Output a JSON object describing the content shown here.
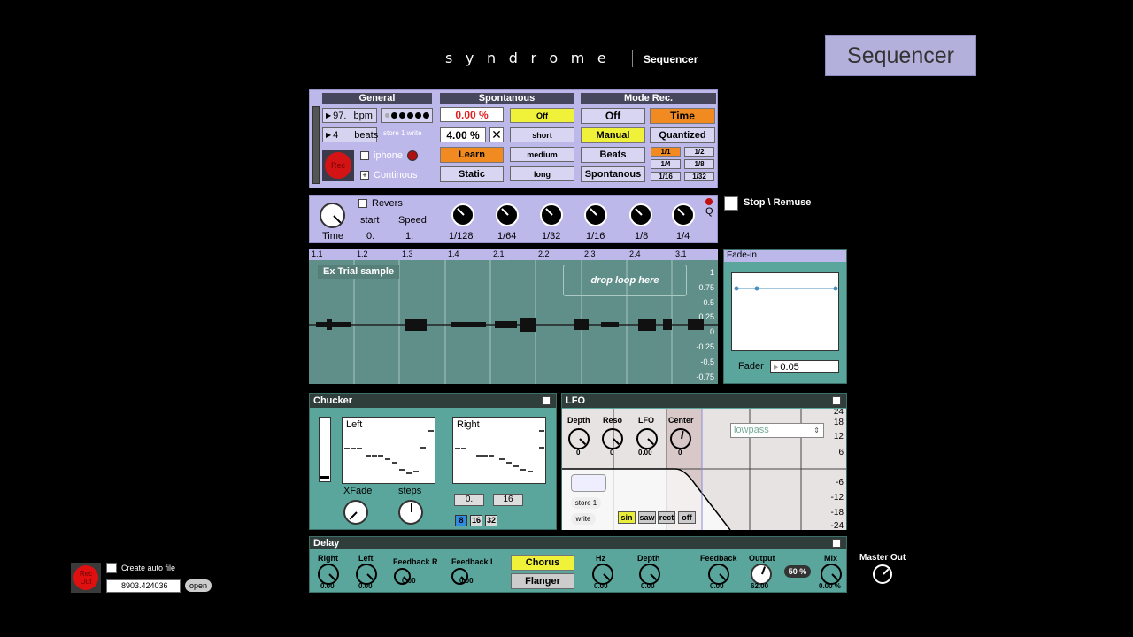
{
  "title": {
    "brand": "syndrome",
    "sub": "Sequencer"
  },
  "sequencer_button": "Sequencer",
  "general": {
    "header": "General",
    "bpm_value": "97.",
    "bpm_unit": "bpm",
    "beats_value": "4",
    "beats_unit": "beats",
    "store_write": "store 1 write",
    "rec_label": "Rec",
    "iphone_label": "iphone",
    "continous_label": "Continous"
  },
  "spontanous": {
    "header": "Spontanous",
    "percent1": "0.00 %",
    "percent2": "4.00 %",
    "learn": "Learn",
    "static": "Static",
    "off": "Off",
    "short": "short",
    "medium": "medium",
    "long": "long"
  },
  "mode_rec": {
    "header": "Mode Rec.",
    "off": "Off",
    "time": "Time",
    "manual": "Manual",
    "quantized": "Quantized",
    "beats": "Beats",
    "spontanous": "Spontanous",
    "fractions": [
      "1/1",
      "1/2",
      "1/4",
      "1/8",
      "1/16",
      "1/32"
    ]
  },
  "transport": {
    "time_label": "Time",
    "revers_label": "Revers",
    "start_label": "start",
    "speed_label": "Speed",
    "start_value": "0.",
    "speed_value": "1.",
    "knob_labels": [
      "1/128",
      "1/64",
      "1/32",
      "1/16",
      "1/8",
      "1/4"
    ],
    "q_label": "Q"
  },
  "stop_remuse": "Stop \\ Remuse",
  "waveform": {
    "ruler": [
      "1.1",
      "1.2",
      "1.3",
      "1.4",
      "2.1",
      "2.2",
      "2.3",
      "2.4",
      "3.1"
    ],
    "sample_name": "Ex Trial sample",
    "drop_hint": "drop loop here",
    "scale": [
      "1",
      "0.75",
      "0.5",
      "0.25",
      "0",
      "-0.25",
      "-0.5",
      "-0.75"
    ]
  },
  "fade_in": {
    "header": "Fade-in",
    "fader_label": "Fader",
    "fader_value": "0.05"
  },
  "chucker": {
    "header": "Chucker",
    "left_label": "Left",
    "right_label": "Right",
    "xfade_label": "XFade",
    "steps_label": "steps",
    "val_a": "0.",
    "val_b": "16",
    "step_options": [
      "8",
      "16",
      "32"
    ]
  },
  "lfo": {
    "header": "LFO",
    "knob_labels": [
      "Depth",
      "Reso",
      "LFO",
      "Center"
    ],
    "knob_values": [
      "0",
      "0",
      "0.00",
      "0"
    ],
    "filter_type": "lowpass",
    "scale": [
      "24",
      "18",
      "12",
      "6",
      "-6",
      "-12",
      "-18",
      "-24"
    ],
    "store": "store 1",
    "write": "write",
    "waves": [
      "sin",
      "saw",
      "rect",
      "off"
    ]
  },
  "delay": {
    "header": "Delay",
    "knobs": [
      {
        "label": "Right",
        "value": "0.00"
      },
      {
        "label": "Left",
        "value": "0.00"
      },
      {
        "label": "Feedback R",
        "value": "0.00"
      },
      {
        "label": "Feedback L",
        "value": "0.00"
      }
    ],
    "chorus": "Chorus",
    "flanger": "Flanger",
    "knobs2": [
      {
        "label": "Hz",
        "value": "0.00"
      },
      {
        "label": "Depth",
        "value": "0.00"
      },
      {
        "label": "Feedback",
        "value": "0.00"
      },
      {
        "label": "Output",
        "value": "62.00"
      },
      {
        "label": "Mix",
        "value": "0.00 %"
      }
    ],
    "percent_badge": "50 %"
  },
  "master_out": "Master Out",
  "rec_out": {
    "label": "Rec Out",
    "create_auto_file": "Create auto file",
    "filename": "8903.424036",
    "open": "open"
  }
}
